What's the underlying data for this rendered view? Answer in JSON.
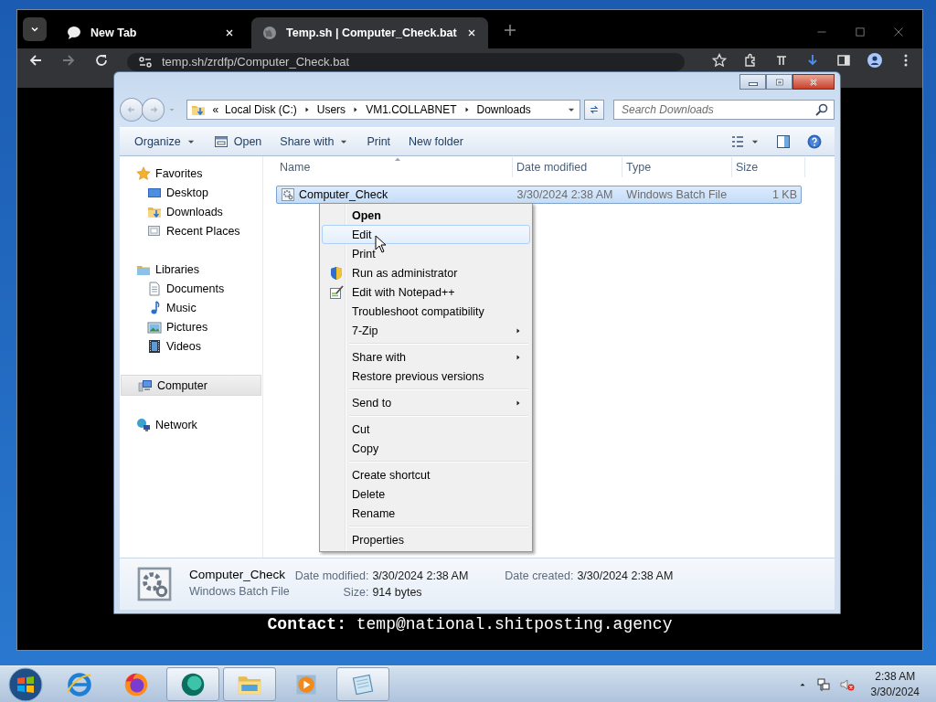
{
  "browser": {
    "tabs": [
      {
        "title": "New Tab",
        "selected": false
      },
      {
        "title": "Temp.sh | Computer_Check.bat",
        "selected": true
      }
    ],
    "url": "temp.sh/zrdfp/Computer_Check.bat",
    "page_text": "**Contact:** temp@national.shitposting.agency"
  },
  "explorer": {
    "breadcrumb": {
      "overflow": "«",
      "parts": [
        "Local Disk (C:)",
        "Users",
        "VM1.COLLABNET",
        "Downloads"
      ]
    },
    "search": {
      "placeholder": "Search Downloads"
    },
    "commands": [
      {
        "label": "Organize",
        "kind": "menu"
      },
      {
        "label": "Open",
        "kind": "icon"
      },
      {
        "label": "Share with",
        "kind": "menu"
      },
      {
        "label": "Print",
        "kind": "plain"
      },
      {
        "label": "New folder",
        "kind": "plain"
      }
    ],
    "nav": [
      {
        "label": "Favorites",
        "selected": false,
        "children": [
          {
            "label": "Desktop",
            "selected": false
          },
          {
            "label": "Downloads",
            "selected": false
          },
          {
            "label": "Recent Places",
            "selected": false
          }
        ]
      },
      {
        "label": "Libraries",
        "selected": false,
        "children": [
          {
            "label": "Documents",
            "selected": false
          },
          {
            "label": "Music",
            "selected": false
          },
          {
            "label": "Pictures",
            "selected": false
          },
          {
            "label": "Videos",
            "selected": false
          }
        ]
      },
      {
        "label": "Computer",
        "selected": true
      },
      {
        "label": "Network",
        "selected": false
      }
    ],
    "columns": [
      {
        "label": "Name",
        "sorted": true
      },
      {
        "label": "Date modified",
        "sorted": false
      },
      {
        "label": "Type",
        "sorted": false
      },
      {
        "label": "Size",
        "sorted": false
      }
    ],
    "rows": [
      {
        "name": "Computer_Check",
        "date_modified": "3/30/2024 2:38 AM",
        "type": "Windows Batch File",
        "size": "1 KB",
        "selected": true
      }
    ],
    "details": {
      "name": "Computer_Check",
      "type": "Windows Batch File",
      "fields": [
        {
          "label": "Date modified:",
          "value": "3/30/2024 2:38 AM"
        },
        {
          "label": "Date created:",
          "value": "3/30/2024 2:38 AM"
        },
        {
          "label": "Size:",
          "value": "914 bytes"
        }
      ]
    }
  },
  "context_menu": {
    "items": [
      {
        "kind": "item",
        "label": "Open",
        "default": true,
        "selected": false
      },
      {
        "kind": "item",
        "label": "Edit",
        "default": false,
        "selected": true
      },
      {
        "kind": "item",
        "label": "Print",
        "default": false,
        "selected": false
      },
      {
        "kind": "item",
        "label": "Run as administrator",
        "default": false,
        "selected": false
      },
      {
        "kind": "item",
        "label": "Edit with Notepad++",
        "default": false,
        "selected": false
      },
      {
        "kind": "item",
        "label": "Troubleshoot compatibility",
        "default": false,
        "selected": false
      },
      {
        "kind": "item",
        "label": "7-Zip",
        "submenu": true,
        "default": false,
        "selected": false
      },
      {
        "kind": "separator"
      },
      {
        "kind": "item",
        "label": "Share with",
        "submenu": true,
        "default": false,
        "selected": false
      },
      {
        "kind": "item",
        "label": "Restore previous versions",
        "default": false,
        "selected": false
      },
      {
        "kind": "separator"
      },
      {
        "kind": "item",
        "label": "Send to",
        "submenu": true,
        "default": false,
        "selected": false
      },
      {
        "kind": "separator"
      },
      {
        "kind": "item",
        "label": "Cut",
        "default": false,
        "selected": false
      },
      {
        "kind": "item",
        "label": "Copy",
        "default": false,
        "selected": false
      },
      {
        "kind": "separator"
      },
      {
        "kind": "item",
        "label": "Create shortcut",
        "default": false,
        "selected": false
      },
      {
        "kind": "item",
        "label": "Delete",
        "default": false,
        "selected": false
      },
      {
        "kind": "item",
        "label": "Rename",
        "default": false,
        "selected": false
      },
      {
        "kind": "separator"
      },
      {
        "kind": "item",
        "label": "Properties",
        "default": false,
        "selected": false
      }
    ]
  },
  "taskbar": {
    "apps": [
      {
        "running": false
      },
      {
        "running": false
      },
      {
        "running": true
      },
      {
        "running": true
      },
      {
        "running": false
      },
      {
        "running": true
      }
    ],
    "clock": {
      "time": "2:38 AM",
      "date": "3/30/2024"
    }
  }
}
